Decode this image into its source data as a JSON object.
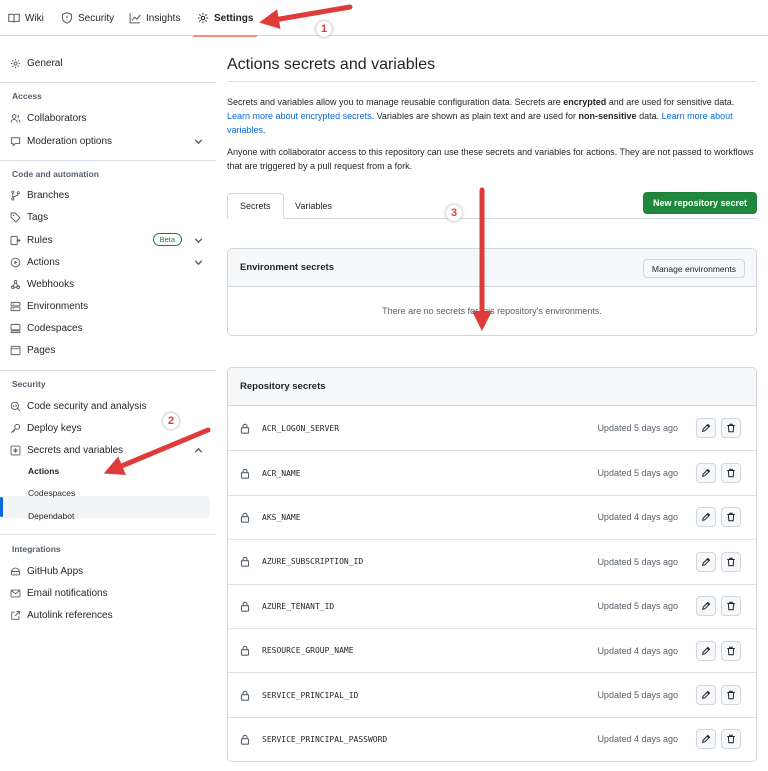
{
  "topnav": {
    "tabs": [
      {
        "label": "Wiki",
        "icon": "book-icon"
      },
      {
        "label": "Security",
        "icon": "shield-icon"
      },
      {
        "label": "Insights",
        "icon": "graph-icon"
      },
      {
        "label": "Settings",
        "icon": "gear-icon",
        "active": true
      }
    ]
  },
  "sidebar": {
    "general": "General",
    "access_heading": "Access",
    "collaborators": "Collaborators",
    "moderation": "Moderation options",
    "code_heading": "Code and automation",
    "branches": "Branches",
    "tags": "Tags",
    "rules": "Rules",
    "rules_badge": "Beta",
    "actions": "Actions",
    "webhooks": "Webhooks",
    "environments": "Environments",
    "codespaces": "Codespaces",
    "pages": "Pages",
    "security_heading": "Security",
    "code_security": "Code security and analysis",
    "deploy_keys": "Deploy keys",
    "secrets_vars": "Secrets and variables",
    "sub_actions": "Actions",
    "sub_codespaces": "Codespaces",
    "sub_dependabot": "Dependabot",
    "integrations_heading": "Integrations",
    "github_apps": "GitHub Apps",
    "email_notifications": "Email notifications",
    "autolink": "Autolink references"
  },
  "main": {
    "title": "Actions secrets and variables",
    "intro_1": "Secrets and variables allow you to manage reusable configuration data. Secrets are ",
    "intro_encrypted": "encrypted",
    "intro_2": " and are used for sensitive data. ",
    "intro_link1": "Learn more about encrypted secrets",
    "intro_3": ". Variables are shown as plain text and are used for ",
    "intro_nonsensitive": "non-sensitive",
    "intro_4": " data. ",
    "intro_link2": "Learn more about variables",
    "intro_5": ".",
    "access_note": "Anyone with collaborator access to this repository can use these secrets and variables for actions. They are not passed to workflows that are triggered by a pull request from a fork.",
    "tab_secrets": "Secrets",
    "tab_variables": "Variables",
    "new_secret_button": "New repository secret",
    "env_secrets_title": "Environment secrets",
    "manage_env_button": "Manage environments",
    "env_empty": "There are no secrets for this repository's environments.",
    "repo_secrets_title": "Repository secrets",
    "secrets": [
      {
        "name": "ACR_LOGON_SERVER",
        "updated": "Updated 5 days ago"
      },
      {
        "name": "ACR_NAME",
        "updated": "Updated 5 days ago"
      },
      {
        "name": "AKS_NAME",
        "updated": "Updated 4 days ago"
      },
      {
        "name": "AZURE_SUBSCRIPTION_ID",
        "updated": "Updated 5 days ago"
      },
      {
        "name": "AZURE_TENANT_ID",
        "updated": "Updated 5 days ago"
      },
      {
        "name": "RESOURCE_GROUP_NAME",
        "updated": "Updated 4 days ago"
      },
      {
        "name": "SERVICE_PRINCIPAL_ID",
        "updated": "Updated 5 days ago"
      },
      {
        "name": "SERVICE_PRINCIPAL_PASSWORD",
        "updated": "Updated 4 days ago"
      }
    ]
  },
  "annotations": {
    "step1": "1",
    "step2": "2",
    "step3": "3",
    "arrow_color": "#e03b3b"
  },
  "colors": {
    "accent": "#0969da",
    "primary_button": "#1f883d",
    "active_tab_underline": "#fd8c73"
  }
}
